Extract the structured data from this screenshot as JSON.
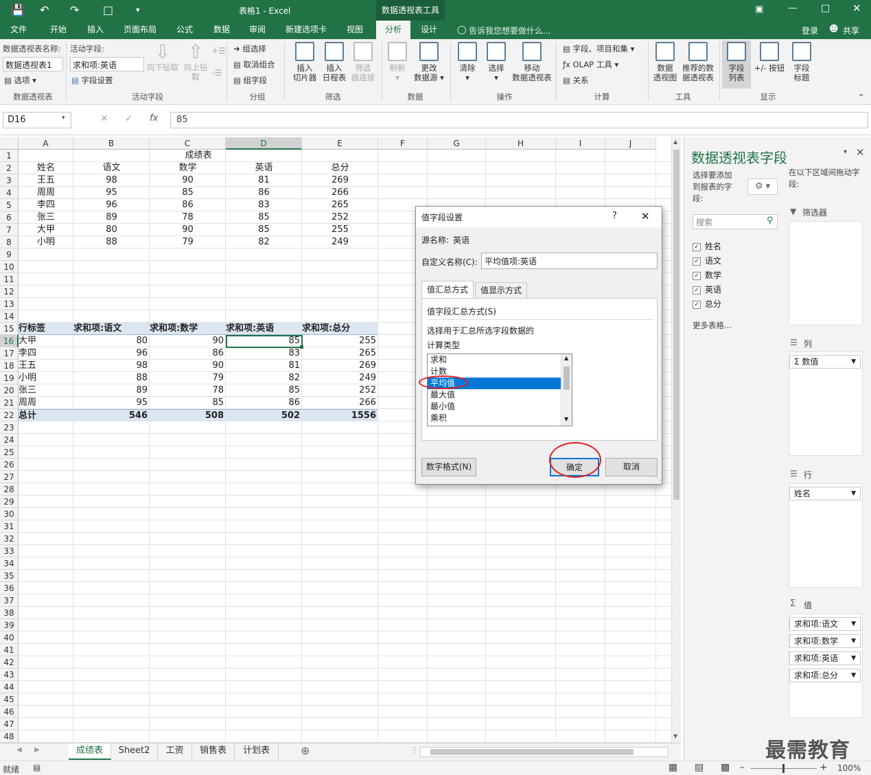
{
  "titlebar": {
    "doc_title": "表格1 - Excel",
    "context_tab": "数据透视表工具"
  },
  "tabs": [
    "文件",
    "开始",
    "插入",
    "页面布局",
    "公式",
    "数据",
    "审阅",
    "新建选项卡",
    "视图",
    "分析",
    "设计"
  ],
  "active_tab": "分析",
  "tell_me": "告诉我您想要做什么...",
  "login": "登录",
  "share": "共享",
  "ribbon": {
    "pivot_name_label": "数据透视表名称:",
    "pivot_name_value": "数据透视表1",
    "options_label": "选项",
    "active_field_label": "活动字段:",
    "active_field_value": "求和项:英语",
    "field_settings": "字段设置",
    "drill_down": "向下钻取",
    "drill_up_1": "向上钻",
    "drill_up_2": "取",
    "group_selection": "组选择",
    "ungroup": "取消组合",
    "group_field": "组字段",
    "insert_slicer_1": "插入",
    "insert_slicer_2": "切片器",
    "insert_timeline_1": "插入",
    "insert_timeline_2": "日程表",
    "filter_conn_1": "筛选",
    "filter_conn_2": "器连接",
    "refresh": "刷新",
    "change_source_1": "更改",
    "change_source_2": "数据源",
    "clear": "清除",
    "select": "选择",
    "move_1": "移动",
    "move_2": "数据透视表",
    "fields_items": "字段、项目和集",
    "olap": "OLAP 工具",
    "relations": "关系",
    "pivot_chart_1": "数据",
    "pivot_chart_2": "透视图",
    "recommended_1": "推荐的数",
    "recommended_2": "据透视表",
    "field_list_1": "字段",
    "field_list_2": "列表",
    "plus_minus": "+/- 按钮",
    "field_headers_1": "字段",
    "field_headers_2": "标题",
    "groups": [
      "数据透视表",
      "活动字段",
      "分组",
      "筛选",
      "数据",
      "操作",
      "计算",
      "工具",
      "显示"
    ]
  },
  "formula": {
    "name_box": "D16",
    "value": "85",
    "fx": "fx"
  },
  "columns": [
    "A",
    "B",
    "C",
    "D",
    "E",
    "F",
    "G",
    "H",
    "I",
    "J"
  ],
  "rows": [
    "1",
    "2",
    "3",
    "4",
    "5",
    "6",
    "7",
    "8",
    "9",
    "10",
    "11",
    "12",
    "13",
    "14",
    "15",
    "16",
    "17",
    "18",
    "19",
    "20",
    "21",
    "22",
    "23",
    "24",
    "25",
    "26",
    "27",
    "28",
    "29",
    "30",
    "31",
    "32",
    "33",
    "34",
    "35",
    "36",
    "37",
    "38",
    "39",
    "40",
    "41",
    "42",
    "43",
    "44",
    "45",
    "46",
    "47",
    "48"
  ],
  "sheet": {
    "title": "成绩表",
    "headers": [
      "姓名",
      "语文",
      "数学",
      "英语",
      "总分"
    ],
    "data": [
      [
        "王五",
        "98",
        "90",
        "81",
        "269"
      ],
      [
        "周周",
        "95",
        "85",
        "86",
        "266"
      ],
      [
        "李四",
        "96",
        "86",
        "83",
        "265"
      ],
      [
        "张三",
        "89",
        "78",
        "85",
        "252"
      ],
      [
        "大甲",
        "80",
        "90",
        "85",
        "255"
      ],
      [
        "小明",
        "88",
        "79",
        "82",
        "249"
      ]
    ]
  },
  "pivot": {
    "headers": [
      "行标签",
      "求和项:语文",
      "求和项:数学",
      "求和项:英语",
      "求和项:总分"
    ],
    "rows": [
      [
        "大甲",
        "80",
        "90",
        "85",
        "255"
      ],
      [
        "李四",
        "96",
        "86",
        "83",
        "265"
      ],
      [
        "王五",
        "98",
        "90",
        "81",
        "269"
      ],
      [
        "小明",
        "88",
        "79",
        "82",
        "249"
      ],
      [
        "张三",
        "89",
        "78",
        "85",
        "252"
      ],
      [
        "周周",
        "95",
        "85",
        "86",
        "266"
      ]
    ],
    "total": [
      "总计",
      "546",
      "508",
      "502",
      "1556"
    ]
  },
  "sheet_tabs": [
    "成绩表",
    "Sheet2",
    "工资",
    "销售表",
    "计划表"
  ],
  "status": {
    "ready": "就绪",
    "zoom": "100%"
  },
  "dialog": {
    "title": "值字段设置",
    "help": "?",
    "source_label": "源名称:",
    "source_value": "英语",
    "custom_label": "自定义名称(C):",
    "custom_value": "平均值项:英语",
    "tab_summarize": "值汇总方式",
    "tab_show": "值显示方式",
    "section": "值字段汇总方式(S)",
    "desc_1": "选择用于汇总所选字段数据的",
    "desc_2": "计算类型",
    "options": [
      "求和",
      "计数",
      "平均值",
      "最大值",
      "最小值",
      "乘积"
    ],
    "selected": "平均值",
    "number_format": "数字格式(N)",
    "ok": "确定",
    "cancel": "取消"
  },
  "panel": {
    "title": "数据透视表字段",
    "choose_fields": "选择要添加到报表的字段:",
    "drag_hint": "在以下区域间拖动字段:",
    "search_placeholder": "搜索",
    "fields": [
      "姓名",
      "语文",
      "数学",
      "英语",
      "总分"
    ],
    "more_tables": "更多表格...",
    "filters_label": "筛选器",
    "columns_label": "列",
    "rows_label": "行",
    "values_label": "值",
    "columns_item": "Σ 数值",
    "rows_item": "姓名",
    "values_items": [
      "求和项:语文",
      "求和项:数学",
      "求和项:英语",
      "求和项:总分"
    ]
  },
  "watermark": "最需教育",
  "colors": {
    "excel_green": "#217346",
    "selection_blue": "#0078d7",
    "highlight_red": "#e02020",
    "pivot_band": "#dce6f1"
  }
}
